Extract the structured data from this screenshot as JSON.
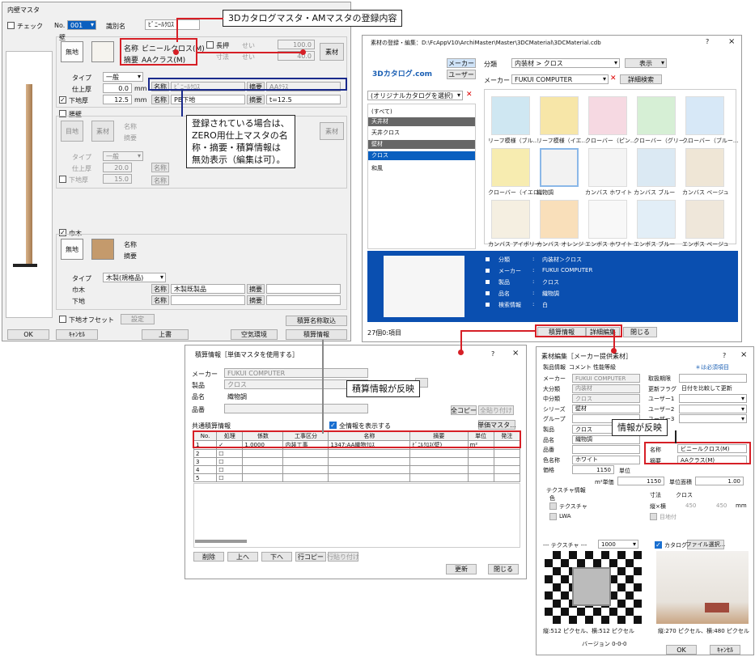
{
  "main": {
    "title": "内壁マスタ",
    "check": "チェック",
    "no_label": "No.",
    "no_value": "001",
    "shikibetsu_label": "識別名",
    "shikibetsu_value": "ﾋﾞﾆｰﾙｸﾛｽ",
    "wall_label": "壁",
    "btn_muchi": "無地",
    "name_label": "名称",
    "name_value": "ビニールクロス(M)",
    "tekiyou_label": "摘要",
    "tekiyou_value": "AAクラス(M)",
    "nagaoshi": "長押",
    "sei1": "せい",
    "sei1_val": "100.0",
    "sunpou": "寸法",
    "sei2": "せい",
    "sei2_val": "40.0",
    "sozai": "素材",
    "type_label": "タイプ",
    "type_value": "一般",
    "shiage_label": "仕上厚",
    "shiage_value": "0.0",
    "mm": "mm",
    "shitaji_label": "下地厚",
    "shitaji_value": "12.5",
    "name_btn": "名称",
    "name2_value": "ﾋﾞﾆｰﾙｸﾛｽ",
    "tekiyou_btn": "摘要",
    "tekiyou2_value": "AAｸﾗｽ",
    "name3_value": "PB下地",
    "tekiyou3_value": "t=12.5",
    "koshikabe": "腰壁",
    "btn_mokuji": "目地",
    "btn_sozai": "素材",
    "kname": "名称",
    "ktekiyou": "摘要",
    "ktype": "タイプ",
    "ktype_val": "一般",
    "kshiage": "仕上厚",
    "kshiage_val": "20.0",
    "kshitaji": "下地厚",
    "kshitaji_val": "15.0",
    "habaki": "巾木",
    "hname": "名称",
    "htekiyou": "摘要",
    "htype": "タイプ",
    "htype_val": "木製(規格品)",
    "h_habaki": "巾木",
    "h_habaki_val": "木製既製品",
    "h_shitaji": "下地",
    "offset": "下地オフセット",
    "settei": "設定",
    "sekisan_name": "積算名称取込",
    "ok": "OK",
    "cancel": "ｷｬﾝｾﾙ",
    "uwagaki": "上書",
    "kuuki": "空気環境",
    "sekisan": "積算情報"
  },
  "callouts": {
    "c1": "3Dカタログマスタ・AMマスタの登録内容",
    "c2": [
      "登録されている場合は、",
      "ZERO用仕上マスタの名",
      "称・摘要・積算情報は",
      "無効表示（編集は可）。"
    ],
    "c3": "積算情報が反映",
    "c4": "情報が反映"
  },
  "catalog": {
    "title": "素材の登録・編集：D:\\FcAppV10\\ArchiMaster\\Master\\3DCMaterial\\3DCMaterial.cdb",
    "logo": "3Dカタログ.com",
    "tab_maker": "メーカー",
    "tab_user": "ユーザー",
    "bunrui": "分類",
    "bunrui_val": "内装材 > クロス",
    "hyouji": "表示",
    "maker": "メーカー",
    "maker_val": "FUKUI COMPUTER",
    "shousai": "詳細検索",
    "orig": "(オリジナルカタログを選択)",
    "tree": [
      "(すべて)",
      "天井材",
      "天井クロス",
      "壁材",
      "クロス",
      "和風"
    ],
    "thumbs": [
      "リーフ模様（ブル...",
      "リーフ模様（イエ...",
      "クローバー（ピン...",
      "クローバー（グリー...",
      "クローバー（ブルー...",
      "クローバー（イエロ...",
      "織物調",
      "カンバス ホワイト",
      "カンバス ブルー",
      "カンバス ベージュ",
      "カンバス アイボリー",
      "カンバス オレンジ",
      "エンボス ホワイト",
      "エンボス ブルー",
      "エンボス ベージュ"
    ],
    "info_keys": [
      "分類",
      "メーカー",
      "製品",
      "品名",
      "検索情報"
    ],
    "info_vals": [
      "内装材＞クロス",
      "FUKUI COMPUTER",
      "クロス",
      "織物調",
      "白"
    ],
    "count": "27個0:項目",
    "sekisan": "積算情報",
    "shousai_hen": "詳細編集",
    "tojiru": "閉じる"
  },
  "sekisan": {
    "title": "積算情報［単価マスタを使用する］",
    "maker": "メーカー",
    "maker_val": "FUKUI COMPUTER",
    "seihin": "製品",
    "seihin_val": "クロス",
    "hinmei": "品名",
    "hinmei_val": "織物調",
    "hinban": "品番",
    "zen_copy": "全コピー",
    "zen_paste": "全貼り付け",
    "kyoutsu": "共通積算情報",
    "zen_show": "全情報を表示する",
    "tanka": "単価マスタ...",
    "headers": [
      "No.",
      "処理",
      "係数",
      "工事区分",
      "名称",
      "摘要",
      "単位",
      "発注"
    ],
    "row1": [
      "1",
      "✓",
      "1.0000",
      "内装工事",
      "1347:AA織物ｸﾛｽ",
      "ﾋﾞﾆﾙｸﾛｽ(壁)",
      "m²",
      ""
    ],
    "rows": [
      "2",
      "3",
      "4",
      "5"
    ],
    "sakujo": "削除",
    "ue": "上へ",
    "shita": "下へ",
    "gyou_copy": "行コピー",
    "gyou_paste": "行貼り付け",
    "koushin": "更新",
    "tojiru": "閉じる"
  },
  "sozai": {
    "title": "素材編集［メーカー提供素材］",
    "tab1": "製品情報",
    "tab2": "コメント",
    "tab3": "性能等級",
    "hissu": "＊は必須項目",
    "left_keys": [
      "メーカー",
      "大分類",
      "中分類",
      "シリーズ",
      "グループ",
      "製品",
      "品名",
      "品番",
      "色名称",
      "価格"
    ],
    "left_vals": [
      "FUKUI COMPUTER",
      "内装材",
      "クロス",
      "壁材",
      "",
      "クロス",
      "織物調",
      "",
      "ホワイト",
      "1150"
    ],
    "tanni": "単位",
    "m2tanka": "m²単価",
    "m2tanka_val": "1150",
    "tanni_menseki": "単位面積",
    "tanni_menseki_val": "1.00",
    "right_keys": [
      "取扱期限",
      "更新フラグ",
      "ユーザー1",
      "ユーザー2",
      "ユーザー3"
    ],
    "koushin_flag_val": "日付を比較して更新",
    "meishou": "名称",
    "meishou_val": "ビニールクロス(M)",
    "tekiyou": "摘要",
    "tekiyou_val": "AAクラス(M)",
    "texture_info": "テクスチャ情報",
    "iro": "色",
    "texture": "テクスチャ",
    "lwa": "LWA",
    "sizai": "寸法",
    "sizai_val": "クロス",
    "tate_yoko": "縦×横",
    "tate": "450",
    "yoko": "450",
    "mm": "mm",
    "me": "目地付",
    "tex_label": "--- テクスチャ ---",
    "tex_size": "1000",
    "catalog": "カタログ",
    "file_select": "ファイル選択...",
    "px1": "縦:512 ピクセル、横:512 ピクセル",
    "px2": "縦:270 ピクセル、横:480 ピクセル",
    "version": "バージョン 0-0-0",
    "ok": "OK",
    "cancel": "ｷｬﾝｾﾙ"
  }
}
